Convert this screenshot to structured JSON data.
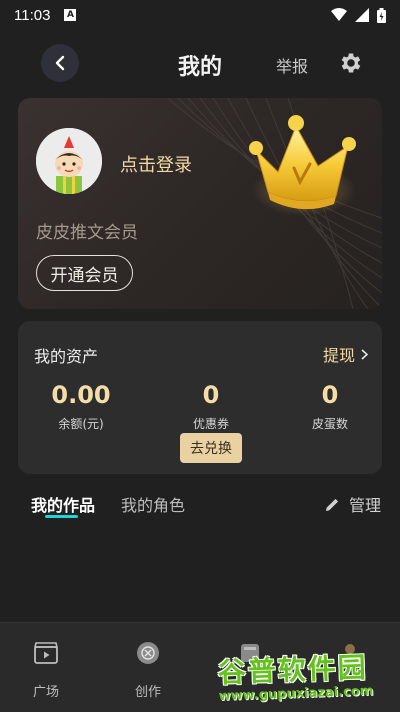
{
  "status_bar": {
    "time": "11:03",
    "notification_badge": "A"
  },
  "header": {
    "title": "我的",
    "report_label": "举报"
  },
  "member_card": {
    "login_text": "点击登录",
    "member_label": "皮皮推文会员",
    "open_member_label": "开通会员"
  },
  "assets": {
    "title": "我的资产",
    "withdraw_label": "提现",
    "items": [
      {
        "value": "0.00",
        "label": "余额(元)"
      },
      {
        "value": "0",
        "label": "优惠券"
      },
      {
        "value": "0",
        "label": "皮蛋数"
      }
    ],
    "redeem_label": "去兑换"
  },
  "tabs": {
    "works": "我的作品",
    "roles": "我的角色",
    "manage": "管理"
  },
  "bottom_nav": [
    {
      "label": "广场",
      "icon": "clapperboard-icon"
    },
    {
      "label": "创作",
      "icon": "create-icon"
    },
    {
      "label": "",
      "icon": "book-icon"
    },
    {
      "label": "",
      "icon": "person-icon"
    }
  ],
  "watermark": {
    "brand": "谷普软件园",
    "url": "www.gupuxiazai.com"
  },
  "colors": {
    "accent_gold": "#f2d9a5",
    "tab_indicator": "#1ed6d6",
    "background": "#202020"
  }
}
